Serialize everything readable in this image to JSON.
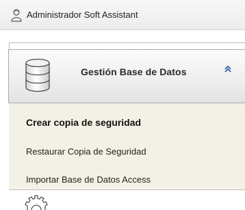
{
  "window": {
    "title": "Administrador Soft Assistant",
    "user_icon": "user-icon"
  },
  "group": {
    "label": "Gestión Base de Datos",
    "icon": "database-icon",
    "collapse_icon": "chevron-up-icon"
  },
  "menu": {
    "items": [
      {
        "label": "Crear copia de seguridad",
        "selected": true
      },
      {
        "label": "Restaurar Copia de Seguridad",
        "selected": false
      },
      {
        "label": "Importar Base de Datos Access",
        "selected": false
      }
    ]
  },
  "next_group": {
    "icon": "gear-icon"
  },
  "colors": {
    "menu_background": "#f3f1e5",
    "header_gradient_top": "#fbfbfb",
    "header_gradient_bottom": "#e2e2e2",
    "chevron": "#2f5fa8"
  }
}
